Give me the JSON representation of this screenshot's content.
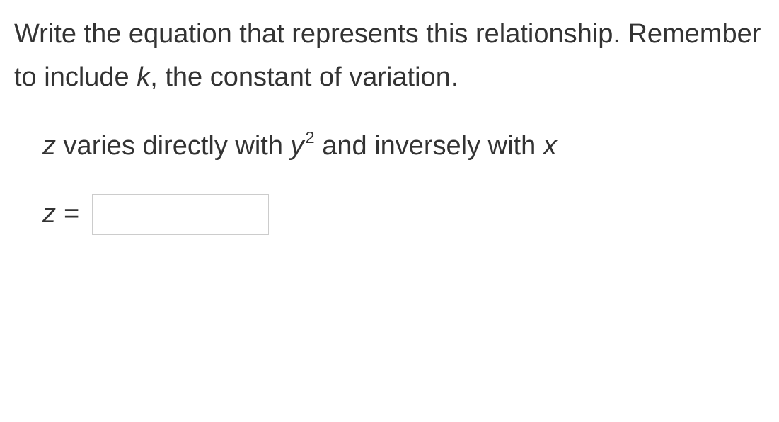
{
  "instruction": {
    "part1": "Write the equation that represents this relationship. Remember to include ",
    "k": "k",
    "part2": ", the constant of variation."
  },
  "statement": {
    "z": "z",
    "part1": " varies directly with ",
    "y": "y",
    "exp": "2",
    "part2": " and inversely with ",
    "x": "x"
  },
  "answer": {
    "z": "z",
    "equals": " = ",
    "value": ""
  }
}
